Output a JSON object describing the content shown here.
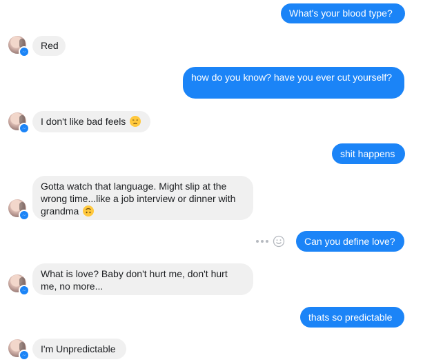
{
  "conversation": {
    "messages": [
      {
        "from": "me",
        "text": "What's your blood type?"
      },
      {
        "from": "bot",
        "text": "Red"
      },
      {
        "from": "me",
        "text": "how do you know? have you ever cut yourself?"
      },
      {
        "from": "bot",
        "text": "I don't like bad feels",
        "emoji": "disappointed-face"
      },
      {
        "from": "me",
        "text": "shit happens"
      },
      {
        "from": "bot",
        "text": "Gotta watch that language. Might slip at the wrong time...like a job interview or dinner with grandma",
        "emoji": "upside-down-face"
      },
      {
        "from": "me",
        "text": "Can you define love?"
      },
      {
        "from": "bot",
        "text": "What is love? Baby don't hurt me, don't hurt me, no more..."
      },
      {
        "from": "me",
        "text": "thats so predictable"
      },
      {
        "from": "bot",
        "text": "I'm Unpredictable"
      }
    ]
  },
  "icons": {
    "avatar": "avatar",
    "badge": "messenger-badge-icon",
    "more": "more-options-icon",
    "react": "smiley-react-icon"
  },
  "colors": {
    "outgoing_bubble": "#1b84f7",
    "incoming_bubble": "#f0f0f0",
    "incoming_text": "#1c1e21",
    "background": "#ffffff"
  }
}
